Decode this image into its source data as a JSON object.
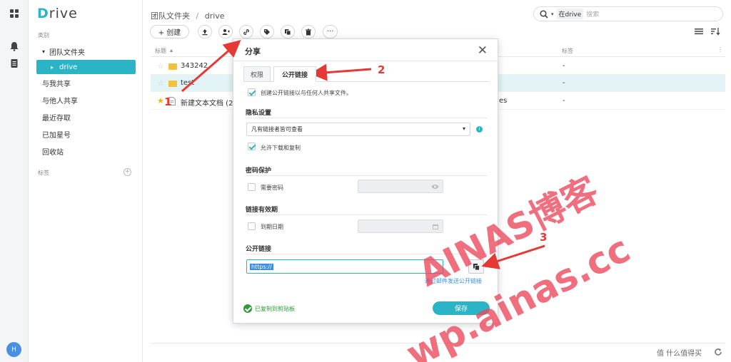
{
  "rail": {
    "icons": [
      "apps-grid-icon",
      "bell-icon",
      "document-icon"
    ],
    "avatar_letter": "H"
  },
  "sidebar": {
    "logo_first": "D",
    "logo_rest": "rive",
    "category_label": "类别",
    "items": [
      {
        "label": "团队文件夹",
        "prefix": "▾"
      },
      {
        "label": "drive",
        "prefix": "▸"
      },
      {
        "label": "与我共享"
      },
      {
        "label": "与他人共享"
      },
      {
        "label": "最近存取"
      },
      {
        "label": "已加星号"
      },
      {
        "label": "回收站"
      }
    ],
    "tags_label": "标签",
    "add_tag_symbol": "+"
  },
  "header": {
    "breadcrumb_root": "团队文件夹",
    "breadcrumb_sep": "/",
    "breadcrumb_current": "drive",
    "search_scope": "在drive",
    "search_placeholder": "搜索"
  },
  "toolbar": {
    "create_label": "+ 创建",
    "more_symbol": "···"
  },
  "table": {
    "col_name": "标题",
    "sort_symbol": "▴",
    "col_tags": "标签",
    "rows": [
      {
        "name": "343242",
        "tag": "-",
        "starred": false,
        "type": "folder"
      },
      {
        "name": "test",
        "tag": "-",
        "starred": false,
        "type": "folder"
      },
      {
        "name": "新建文本文档 (2).",
        "tag": "-",
        "starred": true,
        "type": "file",
        "extra": "es"
      }
    ]
  },
  "modal": {
    "title": "分享",
    "close_symbol": "✕",
    "tabs": [
      "权限",
      "公开链接"
    ],
    "create_link_label": "创建公开链接以与任何人共享文件。",
    "privacy_heading": "隐私设置",
    "privacy_value": "凡有链接者皆可查看",
    "allow_download_label": "允许下载和复制",
    "password_heading": "密码保护",
    "password_label": "需要密码",
    "expiry_heading": "链接有效期",
    "expiry_label": "到期日期",
    "public_link_heading": "公开链接",
    "url_value": "https://",
    "email_link": "通过邮件发送公开链接",
    "save_label": "保存",
    "copied_label": "已复制到剪贴板"
  },
  "annotations": {
    "numbers": [
      "1",
      "2",
      "3"
    ],
    "watermark_line1": "AINAS博客",
    "watermark_line2": "wp.ainas.cc",
    "corner_watermark": "值 什么值得买",
    "arrow_color": "#e53935"
  }
}
